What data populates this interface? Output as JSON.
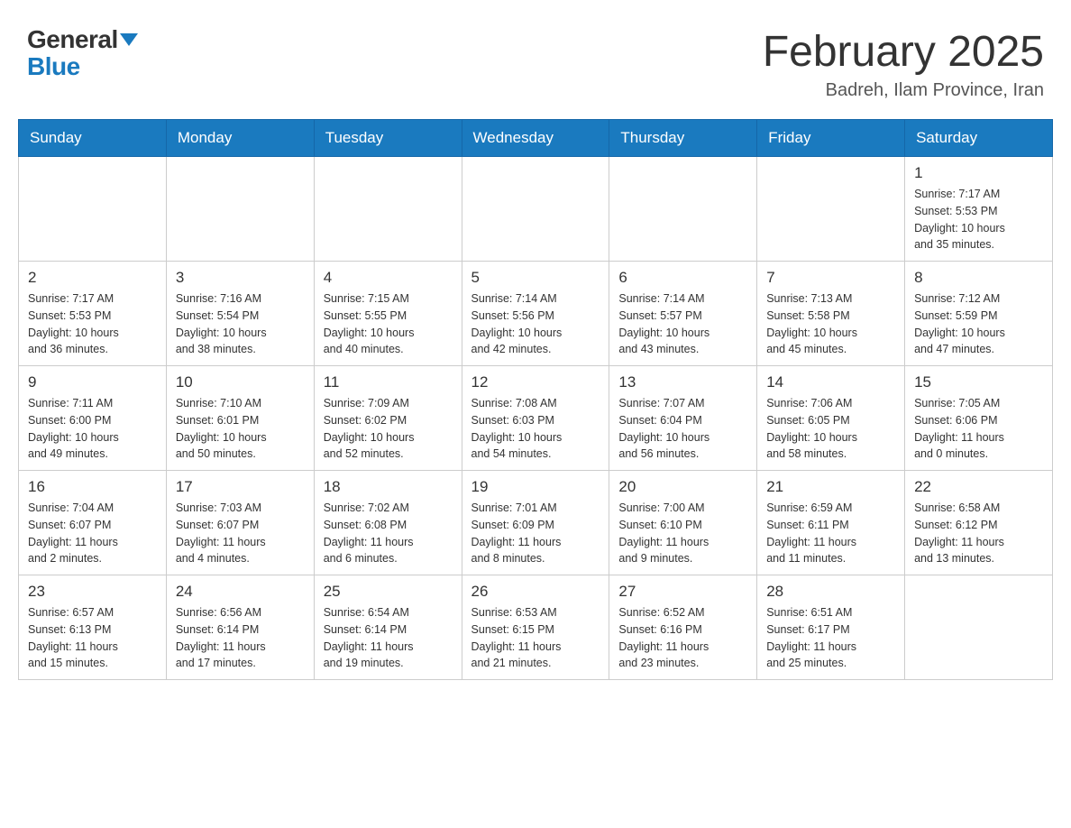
{
  "header": {
    "logo_general": "General",
    "logo_blue": "Blue",
    "month_title": "February 2025",
    "location": "Badreh, Ilam Province, Iran"
  },
  "days_of_week": [
    "Sunday",
    "Monday",
    "Tuesday",
    "Wednesday",
    "Thursday",
    "Friday",
    "Saturday"
  ],
  "weeks": [
    [
      {
        "day": "",
        "info": ""
      },
      {
        "day": "",
        "info": ""
      },
      {
        "day": "",
        "info": ""
      },
      {
        "day": "",
        "info": ""
      },
      {
        "day": "",
        "info": ""
      },
      {
        "day": "",
        "info": ""
      },
      {
        "day": "1",
        "info": "Sunrise: 7:17 AM\nSunset: 5:53 PM\nDaylight: 10 hours\nand 35 minutes."
      }
    ],
    [
      {
        "day": "2",
        "info": "Sunrise: 7:17 AM\nSunset: 5:53 PM\nDaylight: 10 hours\nand 36 minutes."
      },
      {
        "day": "3",
        "info": "Sunrise: 7:16 AM\nSunset: 5:54 PM\nDaylight: 10 hours\nand 38 minutes."
      },
      {
        "day": "4",
        "info": "Sunrise: 7:15 AM\nSunset: 5:55 PM\nDaylight: 10 hours\nand 40 minutes."
      },
      {
        "day": "5",
        "info": "Sunrise: 7:14 AM\nSunset: 5:56 PM\nDaylight: 10 hours\nand 42 minutes."
      },
      {
        "day": "6",
        "info": "Sunrise: 7:14 AM\nSunset: 5:57 PM\nDaylight: 10 hours\nand 43 minutes."
      },
      {
        "day": "7",
        "info": "Sunrise: 7:13 AM\nSunset: 5:58 PM\nDaylight: 10 hours\nand 45 minutes."
      },
      {
        "day": "8",
        "info": "Sunrise: 7:12 AM\nSunset: 5:59 PM\nDaylight: 10 hours\nand 47 minutes."
      }
    ],
    [
      {
        "day": "9",
        "info": "Sunrise: 7:11 AM\nSunset: 6:00 PM\nDaylight: 10 hours\nand 49 minutes."
      },
      {
        "day": "10",
        "info": "Sunrise: 7:10 AM\nSunset: 6:01 PM\nDaylight: 10 hours\nand 50 minutes."
      },
      {
        "day": "11",
        "info": "Sunrise: 7:09 AM\nSunset: 6:02 PM\nDaylight: 10 hours\nand 52 minutes."
      },
      {
        "day": "12",
        "info": "Sunrise: 7:08 AM\nSunset: 6:03 PM\nDaylight: 10 hours\nand 54 minutes."
      },
      {
        "day": "13",
        "info": "Sunrise: 7:07 AM\nSunset: 6:04 PM\nDaylight: 10 hours\nand 56 minutes."
      },
      {
        "day": "14",
        "info": "Sunrise: 7:06 AM\nSunset: 6:05 PM\nDaylight: 10 hours\nand 58 minutes."
      },
      {
        "day": "15",
        "info": "Sunrise: 7:05 AM\nSunset: 6:06 PM\nDaylight: 11 hours\nand 0 minutes."
      }
    ],
    [
      {
        "day": "16",
        "info": "Sunrise: 7:04 AM\nSunset: 6:07 PM\nDaylight: 11 hours\nand 2 minutes."
      },
      {
        "day": "17",
        "info": "Sunrise: 7:03 AM\nSunset: 6:07 PM\nDaylight: 11 hours\nand 4 minutes."
      },
      {
        "day": "18",
        "info": "Sunrise: 7:02 AM\nSunset: 6:08 PM\nDaylight: 11 hours\nand 6 minutes."
      },
      {
        "day": "19",
        "info": "Sunrise: 7:01 AM\nSunset: 6:09 PM\nDaylight: 11 hours\nand 8 minutes."
      },
      {
        "day": "20",
        "info": "Sunrise: 7:00 AM\nSunset: 6:10 PM\nDaylight: 11 hours\nand 9 minutes."
      },
      {
        "day": "21",
        "info": "Sunrise: 6:59 AM\nSunset: 6:11 PM\nDaylight: 11 hours\nand 11 minutes."
      },
      {
        "day": "22",
        "info": "Sunrise: 6:58 AM\nSunset: 6:12 PM\nDaylight: 11 hours\nand 13 minutes."
      }
    ],
    [
      {
        "day": "23",
        "info": "Sunrise: 6:57 AM\nSunset: 6:13 PM\nDaylight: 11 hours\nand 15 minutes."
      },
      {
        "day": "24",
        "info": "Sunrise: 6:56 AM\nSunset: 6:14 PM\nDaylight: 11 hours\nand 17 minutes."
      },
      {
        "day": "25",
        "info": "Sunrise: 6:54 AM\nSunset: 6:14 PM\nDaylight: 11 hours\nand 19 minutes."
      },
      {
        "day": "26",
        "info": "Sunrise: 6:53 AM\nSunset: 6:15 PM\nDaylight: 11 hours\nand 21 minutes."
      },
      {
        "day": "27",
        "info": "Sunrise: 6:52 AM\nSunset: 6:16 PM\nDaylight: 11 hours\nand 23 minutes."
      },
      {
        "day": "28",
        "info": "Sunrise: 6:51 AM\nSunset: 6:17 PM\nDaylight: 11 hours\nand 25 minutes."
      },
      {
        "day": "",
        "info": ""
      }
    ]
  ]
}
